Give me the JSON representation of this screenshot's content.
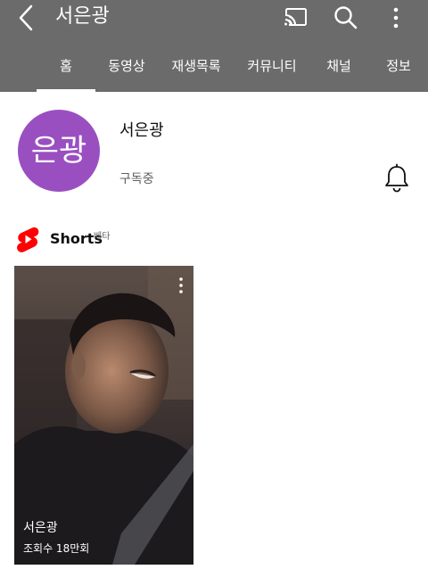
{
  "header": {
    "title": "서은광"
  },
  "tabs": [
    {
      "label": "홈"
    },
    {
      "label": "동영상"
    },
    {
      "label": "재생목록"
    },
    {
      "label": "커뮤니티"
    },
    {
      "label": "채널"
    },
    {
      "label": "정보"
    }
  ],
  "channel": {
    "avatar_text": "은광",
    "name": "서은광",
    "subscription_status": "구독중"
  },
  "shorts": {
    "label": "Shorts",
    "badge": "베타",
    "items": [
      {
        "title": "서은광",
        "views": "조회수 18만회"
      }
    ]
  },
  "colors": {
    "header_bg": "#6b6b6b",
    "avatar_bg": "#9a4fc1",
    "shorts_red": "#ff0000"
  },
  "icons": {
    "back": "back-arrow-icon",
    "cast": "cast-icon",
    "search": "search-icon",
    "more": "more-vert-icon",
    "bell": "bell-icon",
    "shorts": "shorts-logo-icon"
  }
}
